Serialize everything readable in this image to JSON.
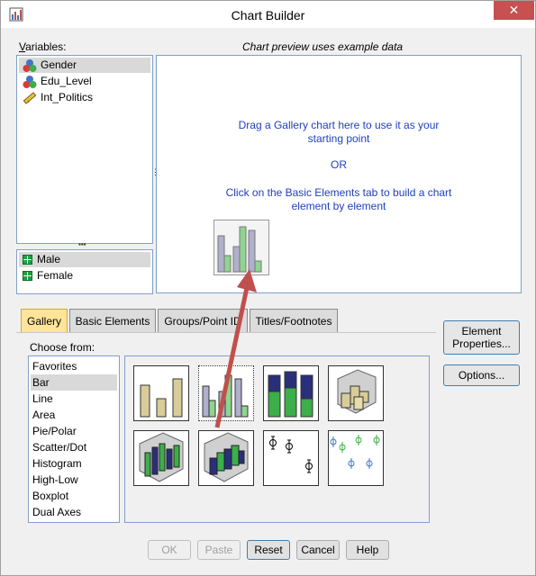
{
  "window": {
    "title": "Chart Builder",
    "close_glyph": "✕"
  },
  "variables": {
    "label": "Variables:",
    "items": [
      {
        "label": "Gender",
        "icon": "nominal-icon",
        "selected": true
      },
      {
        "label": "Edu_Level",
        "icon": "nominal-icon",
        "selected": false
      },
      {
        "label": "Int_Politics",
        "icon": "scale-icon",
        "selected": false
      }
    ]
  },
  "categories": {
    "items": [
      {
        "label": "Male",
        "selected": true
      },
      {
        "label": "Female",
        "selected": false
      }
    ]
  },
  "preview": {
    "caption": "Chart preview uses example data",
    "line1": "Drag a Gallery chart here to use it as your",
    "line2": "starting point",
    "line3": "OR",
    "line4": "Click on the Basic Elements tab to build a chart",
    "line5": "element by element"
  },
  "tabs": [
    {
      "label": "Gallery",
      "active": true
    },
    {
      "label": "Basic Elements",
      "active": false
    },
    {
      "label": "Groups/Point ID",
      "active": false
    },
    {
      "label": "Titles/Footnotes",
      "active": false
    }
  ],
  "gallery": {
    "choose_label": "Choose from:",
    "items": [
      "Favorites",
      "Bar",
      "Line",
      "Area",
      "Pie/Polar",
      "Scatter/Dot",
      "Histogram",
      "High-Low",
      "Boxplot",
      "Dual Axes"
    ],
    "selected": "Bar"
  },
  "side_buttons": {
    "element_properties_line1": "Element",
    "element_properties_line2": "Properties...",
    "options": "Options..."
  },
  "bottom_buttons": {
    "ok": "OK",
    "paste": "Paste",
    "reset": "Reset",
    "cancel": "Cancel",
    "help": "Help"
  },
  "colors": {
    "accent_tab": "#ffe49a",
    "preview_text": "#1f3fbf",
    "arrow": "#c0504d",
    "bar_tan": "#d8cc9a",
    "bar_green": "#8fd48f",
    "bar_navy": "#2a2f7a",
    "bar_lavender": "#b0b0cc"
  }
}
